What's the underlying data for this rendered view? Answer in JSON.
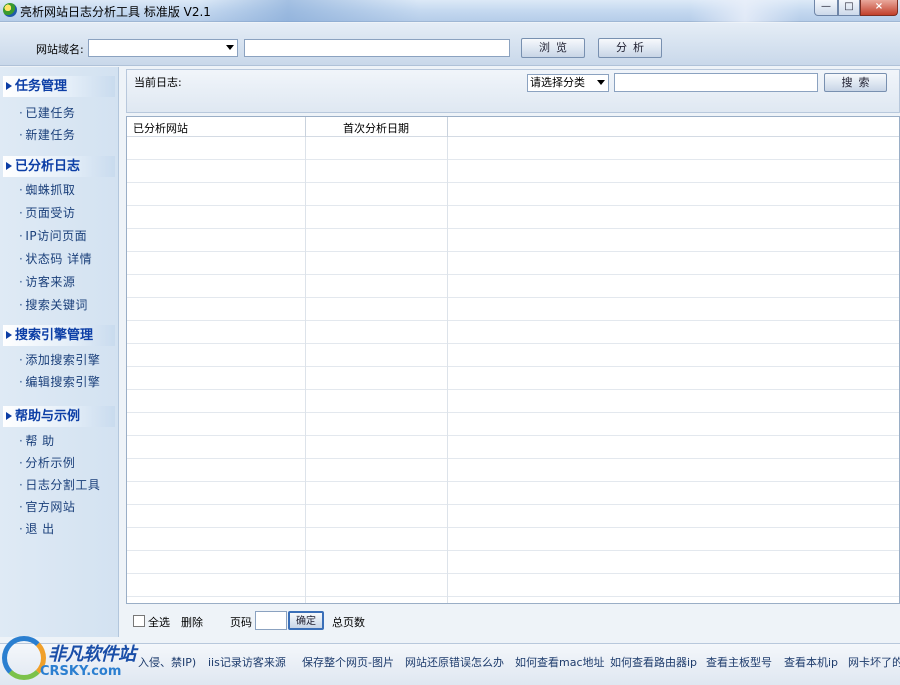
{
  "window": {
    "title": "亮析网站日志分析工具 标准版 V2.1",
    "min_symbol": "—",
    "max_symbol": "□",
    "close_symbol": "×"
  },
  "toolbar": {
    "domain_label": "网站域名:",
    "domain_value": "",
    "path_value": "",
    "browse_label": "浏览",
    "analyze_label": "分析"
  },
  "sidebar": {
    "sections": [
      {
        "title": "任务管理",
        "items": [
          "已建任务",
          "新建任务"
        ]
      },
      {
        "title": "已分析日志",
        "items": [
          "蜘蛛抓取",
          "页面受访",
          "IP访问页面",
          "状态码 详情",
          "访客来源",
          "搜索关键词"
        ]
      },
      {
        "title": "搜索引擎管理",
        "items": [
          "添加搜索引擎",
          "编辑搜索引擎"
        ]
      },
      {
        "title": "帮助与示例",
        "items": [
          "帮 助",
          "分析示例",
          "日志分割工具",
          "官方网站",
          "退 出"
        ]
      }
    ],
    "bullet": "·"
  },
  "main": {
    "current_log_label": "当前日志:",
    "category_select": "请选择分类",
    "search_value": "",
    "search_label": "搜索",
    "columns": [
      "已分析网站",
      "首次分析日期"
    ],
    "bottom": {
      "select_all": "全选",
      "delete": "删除",
      "page_label": "页码",
      "page_value": "",
      "ok_label": "确定",
      "total_pages": "总页数"
    }
  },
  "links": [
    "入侵、禁IP)",
    "iis记录访客来源",
    "保存整个网页-图片",
    "网站还原错误怎么办",
    "如何查看mac地址",
    "如何查看路由器ip",
    "查看主板型号",
    "查看本机ip",
    "网卡坏了的"
  ],
  "logo": {
    "cn": "非凡软件站",
    "en": "CRSKY.com"
  },
  "colors": {
    "accent": "#0c3ea6",
    "sidebar_bg": "#dfeaf5",
    "title_bar": "#c5d9f0"
  }
}
